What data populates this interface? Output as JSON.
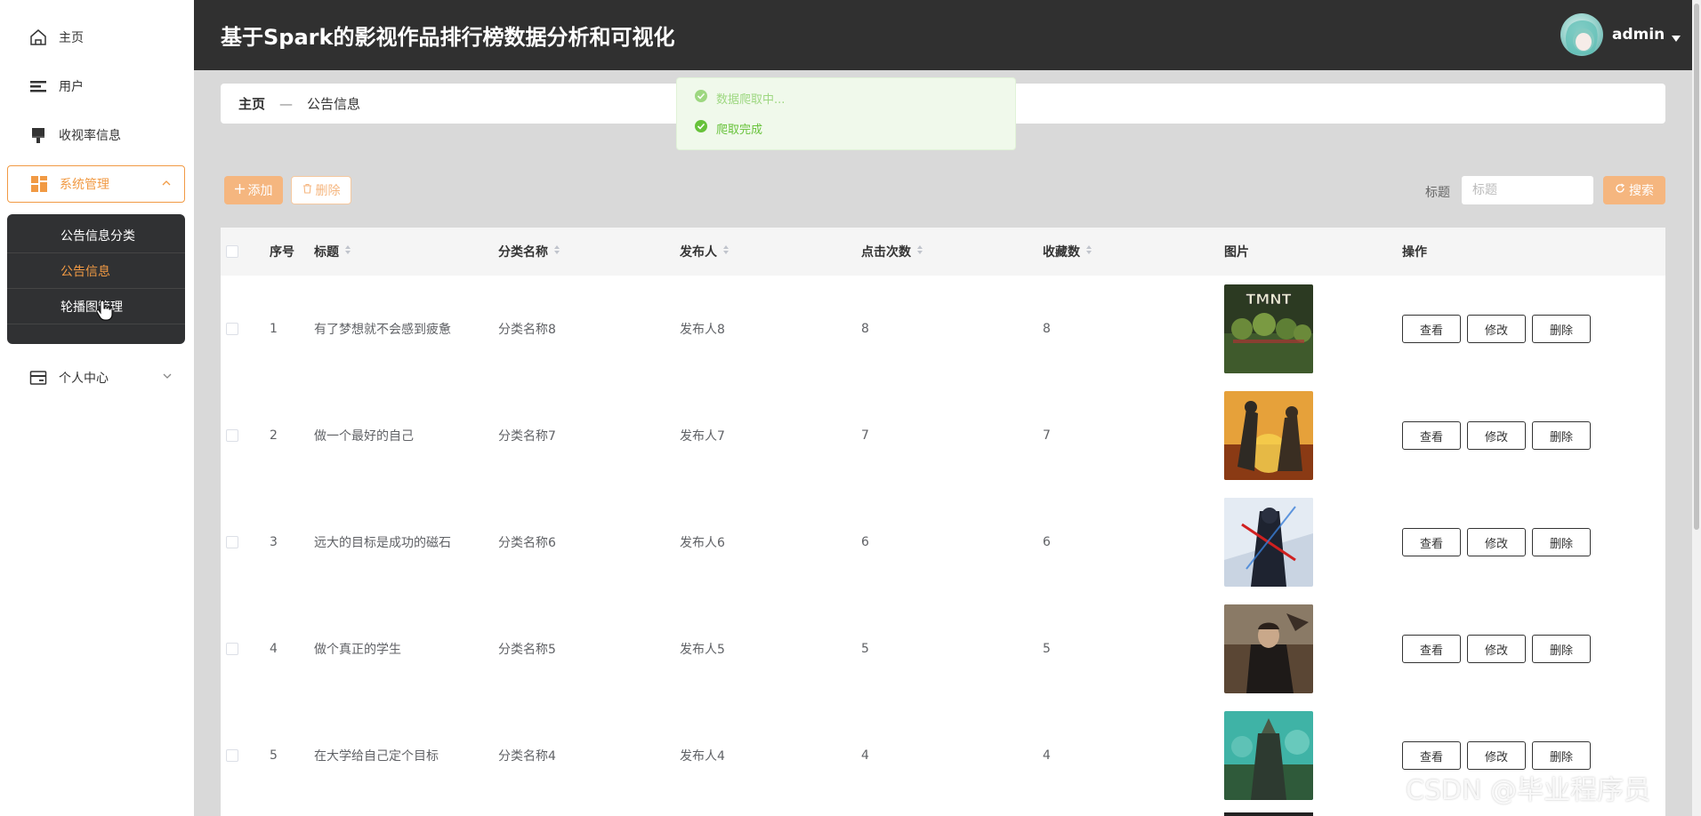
{
  "app": {
    "title": "基于Spark的影视作品排行榜数据分析和可视化",
    "user": "admin"
  },
  "sidebar": {
    "items": [
      {
        "label": "主页",
        "icon": "home-icon"
      },
      {
        "label": "用户",
        "icon": "list-icon"
      },
      {
        "label": "收视率信息",
        "icon": "brush-icon"
      },
      {
        "label": "系统管理",
        "icon": "grid-icon"
      },
      {
        "label": "个人中心",
        "icon": "card-icon"
      }
    ],
    "submenu": [
      {
        "label": "公告信息分类"
      },
      {
        "label": "公告信息"
      },
      {
        "label": "轮播图管理"
      }
    ]
  },
  "breadcrumb": {
    "home": "主页",
    "separator": "—",
    "current": "公告信息"
  },
  "toasts": [
    {
      "text": "数据爬取中..."
    },
    {
      "text": "爬取完成"
    }
  ],
  "toolbar": {
    "add_label": "添加",
    "delete_label": "删除",
    "search_label": "标题",
    "search_placeholder": "标题",
    "search_button": "搜索"
  },
  "table": {
    "headers": [
      "序号",
      "标题",
      "分类名称",
      "发布人",
      "点击次数",
      "收藏数",
      "图片",
      "操作"
    ],
    "actions": [
      "查看",
      "修改",
      "删除"
    ],
    "rows": [
      {
        "index": "1",
        "title": "有了梦想就不会感到疲惫",
        "category": "分类名称8",
        "publisher": "发布人8",
        "clicks": "8",
        "favorites": "8",
        "image_text": "TMNT"
      },
      {
        "index": "2",
        "title": "做一个最好的自己",
        "category": "分类名称7",
        "publisher": "发布人7",
        "clicks": "7",
        "favorites": "7",
        "image_text": ""
      },
      {
        "index": "3",
        "title": "远大的目标是成功的磁石",
        "category": "分类名称6",
        "publisher": "发布人6",
        "clicks": "6",
        "favorites": "6",
        "image_text": ""
      },
      {
        "index": "4",
        "title": "做个真正的学生",
        "category": "分类名称5",
        "publisher": "发布人5",
        "clicks": "5",
        "favorites": "5",
        "image_text": ""
      },
      {
        "index": "5",
        "title": "在大学给自己定个目标",
        "category": "分类名称4",
        "publisher": "发布人4",
        "clicks": "4",
        "favorites": "4",
        "image_text": ""
      }
    ]
  },
  "watermark": "CSDN @毕业程序员",
  "colors": {
    "accent": "#f19a44",
    "header_bg": "#303030",
    "success": "#67c23a",
    "page_bg": "#d9d9d9"
  }
}
